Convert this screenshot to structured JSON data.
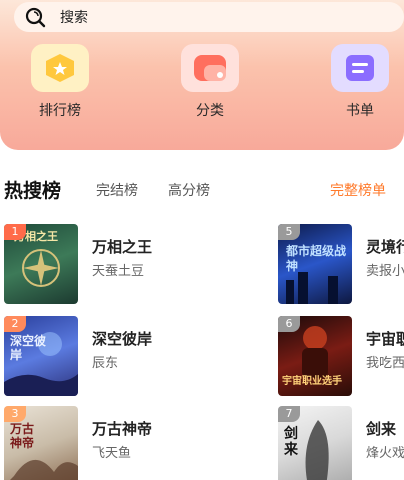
{
  "search": {
    "label": "搜索"
  },
  "nav": [
    {
      "label": "排行榜",
      "icon": "ranking-icon"
    },
    {
      "label": "分类",
      "icon": "category-icon"
    },
    {
      "label": "书单",
      "icon": "booklist-icon"
    }
  ],
  "tabs": {
    "hot": "热搜榜",
    "finished": "完结榜",
    "high_score": "高分榜",
    "full_list": "完整榜单"
  },
  "books_left": [
    {
      "rank": "1",
      "title": "万相之王",
      "author": "天蚕土豆",
      "cover_text": "万相之王"
    },
    {
      "rank": "2",
      "title": "深空彼岸",
      "author": "辰东",
      "cover_text": "深空彼岸"
    },
    {
      "rank": "3",
      "title": "万古神帝",
      "author": "飞天鱼",
      "cover_text": "万古神帝"
    }
  ],
  "books_right": [
    {
      "rank": "5",
      "title": "灵境行",
      "author": "卖报小",
      "cover_text": "都市超级战神"
    },
    {
      "rank": "6",
      "title": "宇宙职",
      "author": "我吃西",
      "cover_text": "宇宙职业选手"
    },
    {
      "rank": "7",
      "title": "剑来",
      "author": "烽火戏",
      "cover_text": "剑来"
    }
  ],
  "colors": {
    "accent": "#ff7a2b",
    "rank1": "#ff6b4a",
    "rank2": "#ff8a5c",
    "rank3": "#ffa96b",
    "rank_other": "#9a9a9a"
  }
}
